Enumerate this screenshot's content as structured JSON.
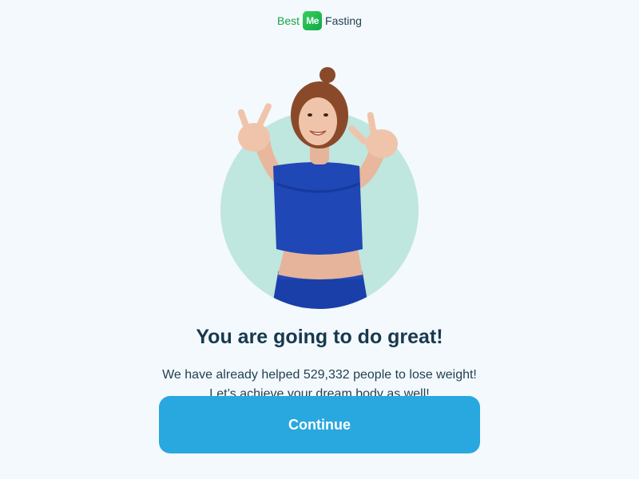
{
  "brand": {
    "prefix": "Best",
    "badge": "Me",
    "suffix": "Fasting"
  },
  "hero": {
    "image": "woman-peace-sign-photo"
  },
  "headline": "You are going to do great!",
  "subtext": {
    "line1": "We have already helped 529,332 people to lose weight!",
    "line2": "Let’s achieve your dream body as well!"
  },
  "continue_button": {
    "label": "Continue"
  },
  "colors": {
    "background": "#f4f9fd",
    "accent": "#29a8e0",
    "brand_green": "#1aa34a",
    "heading": "#17394e",
    "circle": "#bfe6df"
  }
}
